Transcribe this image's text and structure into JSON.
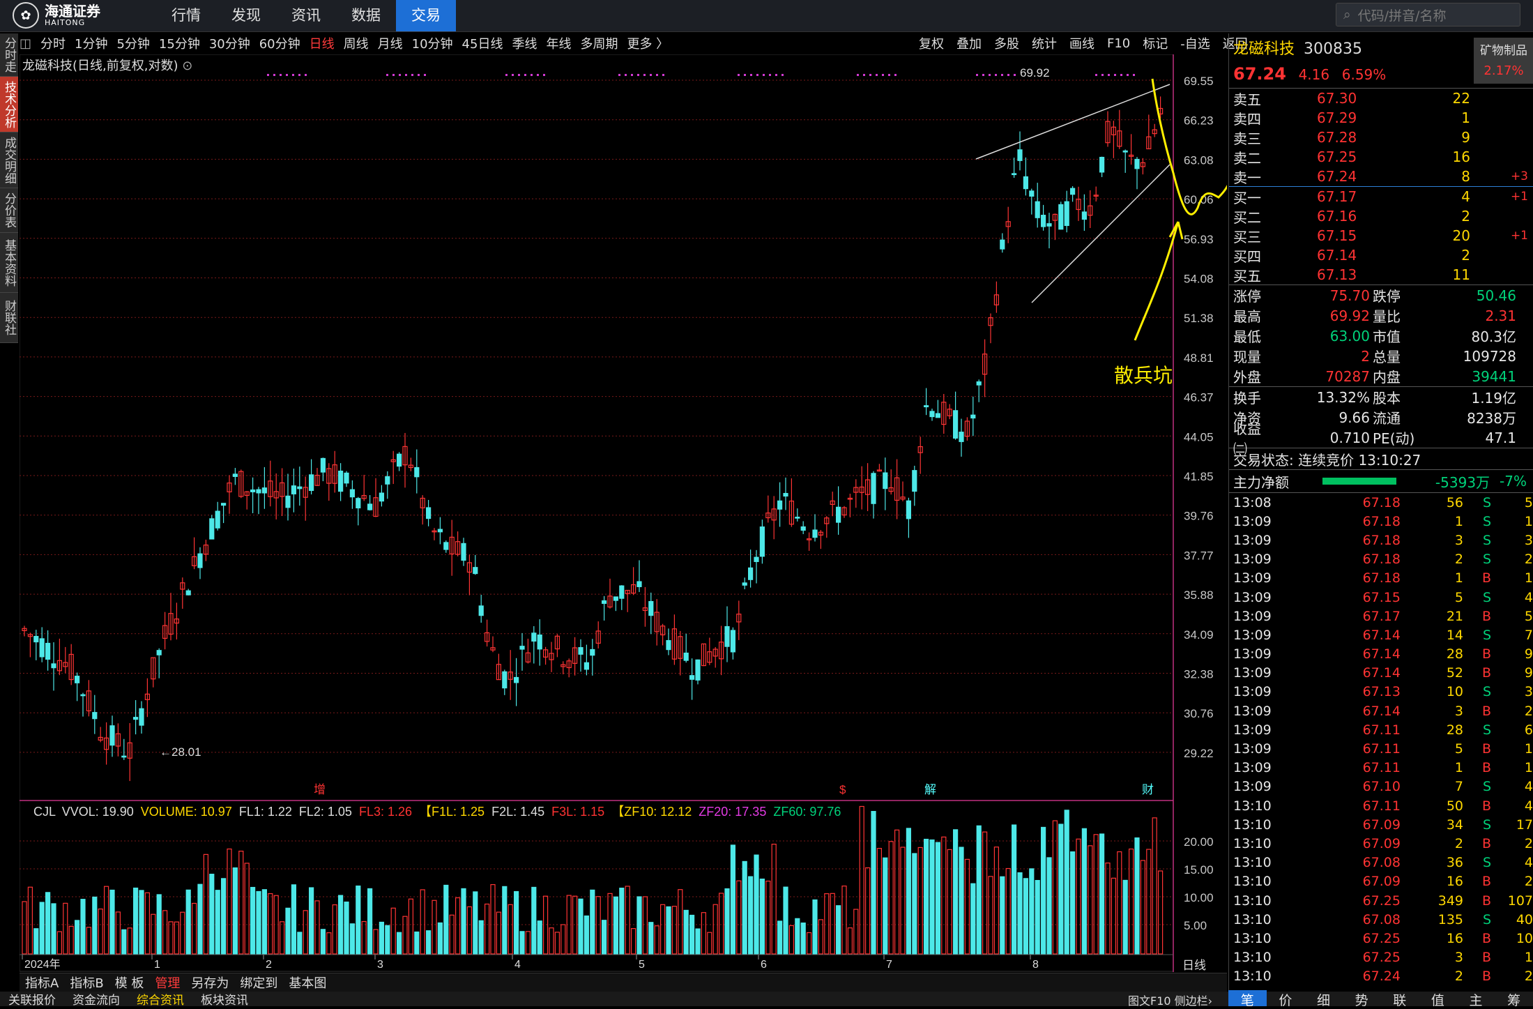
{
  "logo": {
    "cn": "海通证券",
    "en": "HAITONG"
  },
  "topnav": [
    "行情",
    "发现",
    "资讯",
    "数据",
    "交易"
  ],
  "topnav_active": 4,
  "search_placeholder": "代码/拼音/名称",
  "vtabs": [
    "分时走势",
    "技术分析",
    "成交明细",
    "分价表",
    "基本资料",
    "财联社"
  ],
  "vtab_active": 1,
  "periods": [
    "分时",
    "1分钟",
    "5分钟",
    "15分钟",
    "30分钟",
    "60分钟",
    "日线",
    "周线",
    "月线",
    "10分钟",
    "45日线",
    "季线",
    "年线",
    "多周期",
    "更多 〉"
  ],
  "period_active": 6,
  "rtools": [
    "复权",
    "叠加",
    "多股",
    "统计",
    "画线",
    "F10",
    "标记",
    "-自选",
    "返回"
  ],
  "stock_title": "龙磁科技(日线,前复权,对数)",
  "chart_data": {
    "type": "candlestick",
    "price_axis": [
      "69.55",
      "66.23",
      "63.08",
      "60.06",
      "56.93",
      "54.08",
      "51.38",
      "48.81",
      "46.37",
      "44.05",
      "41.85",
      "39.76",
      "37.77",
      "35.88",
      "34.09",
      "32.38",
      "30.76",
      "29.22"
    ],
    "high_label": "69.92",
    "low_label": "←28.01",
    "months": [
      "2024年",
      "1",
      "2",
      "3",
      "4",
      "5",
      "6",
      "7",
      "8"
    ],
    "event_markers": [
      "增",
      "$",
      "解",
      "财"
    ],
    "annotation": "散兵坑",
    "volume_legend": [
      {
        "t": "CJL",
        "c": "#ddd"
      },
      {
        "t": "VVOL: 19.90",
        "c": "#ddd"
      },
      {
        "t": "VOLUME: 10.97",
        "c": "#ffd800"
      },
      {
        "t": "FL1: 1.22",
        "c": "#ddd"
      },
      {
        "t": "FL2: 1.05",
        "c": "#ddd"
      },
      {
        "t": "FL3: 1.26",
        "c": "#ff3333"
      },
      {
        "t": "【F1L: 1.25",
        "c": "#ffd800"
      },
      {
        "t": "F2L: 1.45",
        "c": "#ddd"
      },
      {
        "t": "F3L: 1.15",
        "c": "#ff3333"
      },
      {
        "t": "【ZF10: 12.12",
        "c": "#ffd800"
      },
      {
        "t": "ZF20: 17.35",
        "c": "#e43ae4"
      },
      {
        "t": "ZF60: 97.76",
        "c": "#00d27a"
      }
    ],
    "volume_axis": [
      "20.00",
      "15.00",
      "10.00",
      "5.00"
    ],
    "period_label": "日线"
  },
  "quote": {
    "name": "龙磁科技",
    "code": "300835",
    "sector": "矿物制品",
    "sector_change": "2.17%",
    "price": "67.24",
    "change": "4.16",
    "pct": "6.59%",
    "asks": [
      {
        "label": "卖五",
        "price": "67.30",
        "vol": "22",
        "chg": ""
      },
      {
        "label": "卖四",
        "price": "67.29",
        "vol": "1",
        "chg": ""
      },
      {
        "label": "卖三",
        "price": "67.28",
        "vol": "9",
        "chg": ""
      },
      {
        "label": "卖二",
        "price": "67.25",
        "vol": "16",
        "chg": ""
      },
      {
        "label": "卖一",
        "price": "67.24",
        "vol": "8",
        "chg": "+3"
      }
    ],
    "bids": [
      {
        "label": "买一",
        "price": "67.17",
        "vol": "4",
        "chg": "+1"
      },
      {
        "label": "买二",
        "price": "67.16",
        "vol": "2",
        "chg": ""
      },
      {
        "label": "买三",
        "price": "67.15",
        "vol": "20",
        "chg": "+1"
      },
      {
        "label": "买四",
        "price": "67.14",
        "vol": "2",
        "chg": ""
      },
      {
        "label": "买五",
        "price": "67.13",
        "vol": "11",
        "chg": ""
      }
    ],
    "stats": [
      [
        {
          "l": "涨停",
          "v": "75.70",
          "c": "red"
        },
        {
          "l": "跌停",
          "v": "50.46",
          "c": "green"
        }
      ],
      [
        {
          "l": "最高",
          "v": "69.92",
          "c": "red"
        },
        {
          "l": "量比",
          "v": "2.31",
          "c": "red"
        }
      ],
      [
        {
          "l": "最低",
          "v": "63.00",
          "c": "green"
        },
        {
          "l": "市值",
          "v": "80.3亿",
          "c": "white"
        }
      ],
      [
        {
          "l": "现量",
          "v": "2",
          "c": "red"
        },
        {
          "l": "总量",
          "v": "109728",
          "c": "white"
        }
      ],
      [
        {
          "l": "外盘",
          "v": "70287",
          "c": "red"
        },
        {
          "l": "内盘",
          "v": "39441",
          "c": "green"
        }
      ]
    ],
    "stats2": [
      [
        {
          "l": "换手",
          "v": "13.32%",
          "c": "white"
        },
        {
          "l": "股本",
          "v": "1.19亿",
          "c": "white"
        }
      ],
      [
        {
          "l": "净资",
          "v": "9.66",
          "c": "white"
        },
        {
          "l": "流通",
          "v": "8238万",
          "c": "white"
        }
      ],
      [
        {
          "l": "收益㈡",
          "v": "0.710",
          "c": "white"
        },
        {
          "l": "PE(动)",
          "v": "47.1",
          "c": "white"
        }
      ]
    ],
    "trade_status": "交易状态: 连续竞价 13:10:27",
    "main_flow_label": "主力净额",
    "main_flow_value": "-5393万",
    "main_flow_pct": "-7%",
    "ticks": [
      [
        "13:08",
        "67.18",
        "56",
        "S",
        "5"
      ],
      [
        "13:09",
        "67.18",
        "1",
        "S",
        "1"
      ],
      [
        "13:09",
        "67.18",
        "3",
        "S",
        "3"
      ],
      [
        "13:09",
        "67.18",
        "2",
        "S",
        "2"
      ],
      [
        "13:09",
        "67.18",
        "1",
        "B",
        "1"
      ],
      [
        "13:09",
        "67.15",
        "5",
        "S",
        "4"
      ],
      [
        "13:09",
        "67.17",
        "21",
        "B",
        "5"
      ],
      [
        "13:09",
        "67.14",
        "14",
        "S",
        "7"
      ],
      [
        "13:09",
        "67.14",
        "28",
        "B",
        "9"
      ],
      [
        "13:09",
        "67.14",
        "52",
        "B",
        "9"
      ],
      [
        "13:09",
        "67.13",
        "10",
        "S",
        "3"
      ],
      [
        "13:09",
        "67.14",
        "3",
        "B",
        "2"
      ],
      [
        "13:09",
        "67.11",
        "28",
        "S",
        "6"
      ],
      [
        "13:09",
        "67.11",
        "5",
        "B",
        "1"
      ],
      [
        "13:09",
        "67.11",
        "1",
        "B",
        "1"
      ],
      [
        "13:09",
        "67.10",
        "7",
        "S",
        "4"
      ],
      [
        "13:10",
        "67.11",
        "50",
        "B",
        "4"
      ],
      [
        "13:10",
        "67.09",
        "34",
        "S",
        "17"
      ],
      [
        "13:10",
        "67.09",
        "2",
        "B",
        "2"
      ],
      [
        "13:10",
        "67.08",
        "36",
        "S",
        "4"
      ],
      [
        "13:10",
        "67.09",
        "16",
        "B",
        "2"
      ],
      [
        "13:10",
        "67.25",
        "349",
        "B",
        "107"
      ],
      [
        "13:10",
        "67.08",
        "135",
        "S",
        "40"
      ],
      [
        "13:10",
        "67.25",
        "16",
        "B",
        "10"
      ],
      [
        "13:10",
        "67.25",
        "3",
        "B",
        "1"
      ],
      [
        "13:10",
        "67.24",
        "2",
        "B",
        "2"
      ]
    ]
  },
  "bottom_tabs1": [
    "指标A",
    "指标B",
    "模 板",
    "管理",
    "另存为",
    "绑定到",
    "基本图"
  ],
  "bottom_tabs1_active": 3,
  "bottom_tabs2": [
    "关联报价",
    "资金流向",
    "综合资讯",
    "板块资讯"
  ],
  "bottom_tabs2_active": 2,
  "bottom_right_text": "图文F10 侧边栏›",
  "panel_tabs": [
    "笔",
    "价",
    "细",
    "势",
    "联",
    "值",
    "主",
    "筹"
  ],
  "panel_tab_active": 0
}
